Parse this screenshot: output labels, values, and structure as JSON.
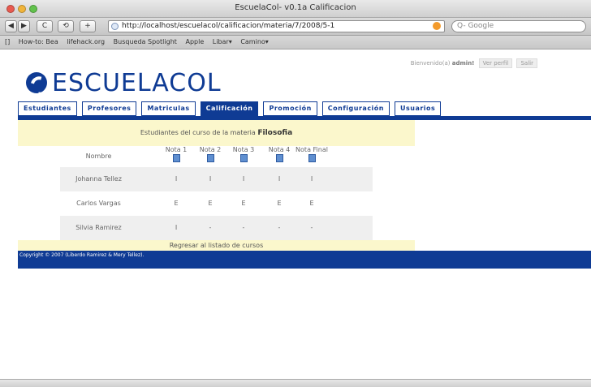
{
  "window": {
    "title": "EscuelaCol- v0.1a Calificacion"
  },
  "toolbar": {
    "back": "◀",
    "forward": "▶",
    "reload": "C",
    "stop": "⟲",
    "add": "+",
    "url": "http://localhost/escuelacol/calificacion/materia/7/2008/5-1",
    "search_placeholder": "Q- Google"
  },
  "bookmarks": {
    "items": [
      "How-to: Bea",
      "lifehack.org",
      "Busqueda Spotlight",
      "Apple",
      "Libar▾",
      "Camino▾"
    ]
  },
  "header": {
    "welcome_prefix": "Bienvenido(a)",
    "user": "admin!",
    "profile_button": "Ver perfil",
    "logout_button": "Salir",
    "logo_text": "ESCUELACOL"
  },
  "tabs": [
    {
      "label": "Estudiantes",
      "active": false
    },
    {
      "label": "Profesores",
      "active": false
    },
    {
      "label": "Matriculas",
      "active": false
    },
    {
      "label": "Calificación",
      "active": true
    },
    {
      "label": "Promoción",
      "active": false
    },
    {
      "label": "Configuración",
      "active": false
    },
    {
      "label": "Usuarios",
      "active": false
    }
  ],
  "content": {
    "caption_prefix": "Estudiantes del curso de la materia",
    "subject": "Filosofia",
    "table": {
      "headers": [
        "Nombre",
        "Nota 1",
        "Nota 2",
        "Nota 3",
        "Nota 4",
        "Nota Final"
      ],
      "rows": [
        {
          "name": "Johanna Tellez",
          "grades": [
            "I",
            "I",
            "I",
            "I",
            "I"
          ]
        },
        {
          "name": "Carlos Vargas",
          "grades": [
            "E",
            "E",
            "E",
            "E",
            "E"
          ]
        },
        {
          "name": "Silvia Ramirez",
          "grades": [
            "I",
            "-",
            "-",
            "-",
            "-"
          ]
        }
      ]
    },
    "back_link": "Regresar al listado de cursos"
  },
  "footer": {
    "copyright": "Copyright © 2007 (Liberdo Ramirez & Mery Tellez)."
  },
  "colors": {
    "brand_blue": "#0f3b94",
    "caption_yellow": "#fbf7cc"
  }
}
